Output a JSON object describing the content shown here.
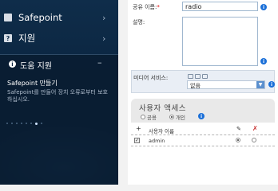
{
  "sidebar": {
    "items": [
      {
        "label": "Safepoint",
        "icon": "safepoint-icon",
        "chevron": "›"
      },
      {
        "label": "지원",
        "icon": "question-icon",
        "icon_glyph": "?",
        "chevron": "›"
      }
    ]
  },
  "help_panel": {
    "title": "도움 지원",
    "collapse": "–",
    "info_glyph": "i",
    "item_title": "Safepoint 만들기",
    "item_desc": "Safepoint를 만들어 장치 오류로부터 보호하십시오."
  },
  "form": {
    "share_name_label": "공유 이름:",
    "required_mark": "*",
    "share_name_value": "radio",
    "description_label": "설명:",
    "media_label": "미디어 서비스:",
    "media_select_value": "없음",
    "info_glyph": "i"
  },
  "access": {
    "title": "사용자 액세스",
    "options": [
      {
        "label": "공용",
        "selected": false
      },
      {
        "label": "개인",
        "selected": true
      }
    ]
  },
  "user_table": {
    "headers": {
      "add": "+",
      "name": "사용자 이름",
      "edit": "✎",
      "delete": "✗"
    },
    "rows": [
      {
        "name": "admin",
        "checked": true,
        "edit_selected": true,
        "delete_selected": false
      }
    ]
  },
  "colors": {
    "sidebar_bg": "#0b2540",
    "info": "#1a6fd8",
    "delete_red": "#c62828"
  }
}
